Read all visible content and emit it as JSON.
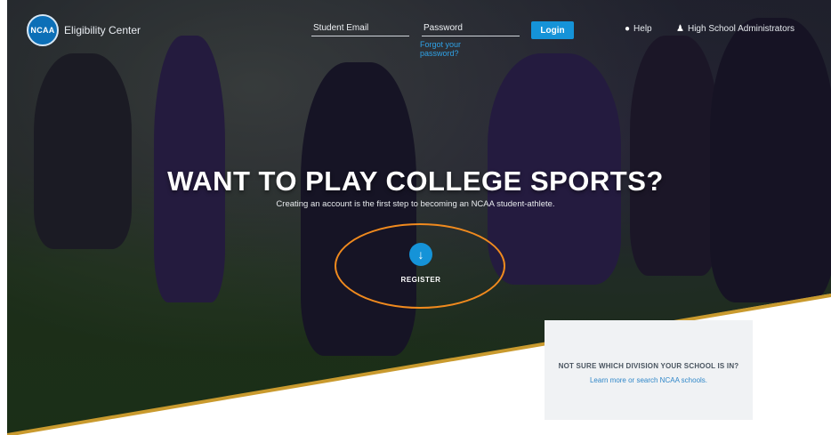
{
  "header": {
    "logo_text": "NCAA",
    "brand": "Eligibility Center",
    "email_label": "Student Email",
    "password_label": "Password",
    "forgot_link": "Forgot your password?",
    "login_button": "Login",
    "help_link": "Help",
    "admin_link": "High School Administrators"
  },
  "hero": {
    "headline": "WANT TO PLAY COLLEGE SPORTS?",
    "subline": "Creating an account is the first step to becoming an NCAA student-athlete.",
    "register_label": "REGISTER"
  },
  "info_card": {
    "title": "NOT SURE WHICH DIVISION YOUR SCHOOL IS IN?",
    "link_text": "Learn more or search NCAA schools."
  },
  "colors": {
    "accent_blue": "#1593d8",
    "highlight_orange": "#f08a1e",
    "stripe_gold": "#c99a2e"
  }
}
